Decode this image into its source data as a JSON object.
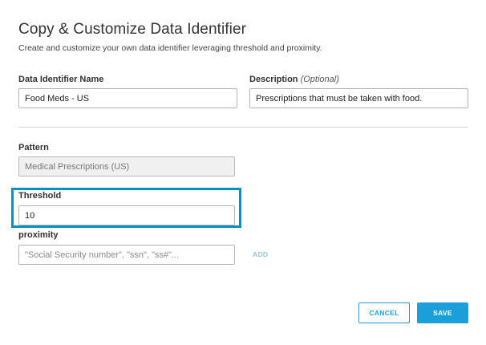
{
  "dialog": {
    "title": "Copy & Customize Data Identifier",
    "subtitle": "Create and customize your own data identifier leveraging threshold and proximity."
  },
  "fields": {
    "name": {
      "label": "Data Identifier Name",
      "value": "Food Meds - US"
    },
    "description": {
      "label": "Description",
      "optional_label": "(Optional)",
      "value": "Prescriptions that must be taken with food."
    },
    "pattern": {
      "label": "Pattern",
      "value": "Medical Prescriptions (US)"
    },
    "threshold": {
      "label": "Threshold",
      "value": "10"
    },
    "proximity": {
      "label": "proximity",
      "placeholder": "\"Social Security number\", \"ssn\", \"ss#\"...",
      "add_label": "ADD"
    }
  },
  "actions": {
    "cancel_label": "CANCEL",
    "save_label": "SAVE"
  },
  "colors": {
    "accent": "#1a9fd9",
    "highlight": "#0a8fc4",
    "add_link": "#8cc6e2"
  }
}
